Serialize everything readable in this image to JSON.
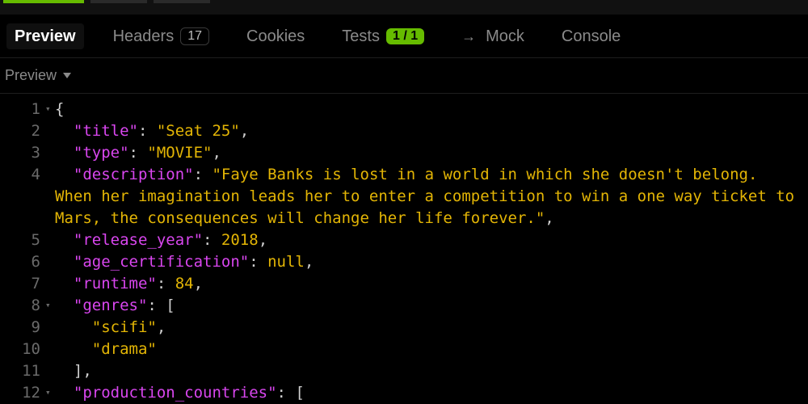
{
  "tabs": {
    "preview": "Preview",
    "headers": "Headers",
    "headers_count": "17",
    "cookies": "Cookies",
    "tests": "Tests",
    "tests_badge": "1 / 1",
    "mock_arrow": "→",
    "mock": "Mock",
    "console": "Console"
  },
  "subbar": {
    "label": "Preview"
  },
  "json": {
    "l1": "{",
    "k_title": "\"title\"",
    "v_title": "\"Seat 25\"",
    "k_type": "\"type\"",
    "v_type": "\"MOVIE\"",
    "k_desc": "\"description\"",
    "v_desc": "\"Faye Banks is lost in a world in which she doesn't belong. When her imagination leads her to enter a competition to win a one way ticket to Mars, the consequences will change her life forever.\"",
    "k_year": "\"release_year\"",
    "v_year": "2018",
    "k_age": "\"age_certification\"",
    "v_age": "null",
    "k_runtime": "\"runtime\"",
    "v_runtime": "84",
    "k_genres": "\"genres\"",
    "v_g1": "\"scifi\"",
    "v_g2": "\"drama\"",
    "k_prod": "\"production_countries\"",
    "open_bracket": "[",
    "close_bracket": "]",
    "colon_sp": ": ",
    "comma": ","
  },
  "gutter": {
    "n1": "1",
    "n2": "2",
    "n3": "3",
    "n4": "4",
    "n5": "5",
    "n6": "6",
    "n7": "7",
    "n8": "8",
    "n9": "9",
    "n10": "10",
    "n11": "11",
    "n12": "12"
  },
  "fold": {
    "tri": "▾"
  }
}
